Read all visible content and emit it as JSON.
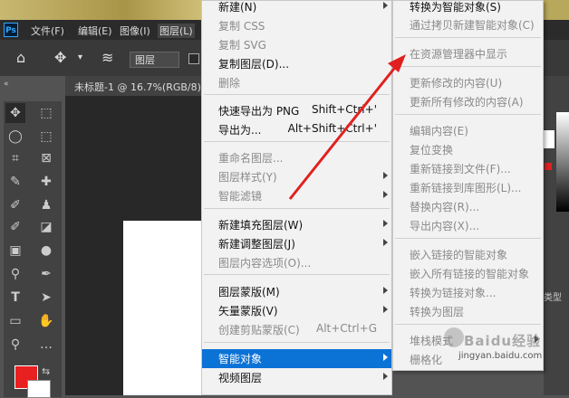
{
  "app": {
    "logo": "Ps",
    "menubar": [
      "文件(F)",
      "编辑(E)",
      "图像(I)",
      "图层(L)"
    ],
    "options": {
      "layer_select": "图层"
    },
    "doc_tab": "未标题-1 @ 16.7%(RGB/8)",
    "right_panel_label": "类型"
  },
  "icons": [
    "home-icon",
    "move-icon",
    "chevron-down-icon",
    "layers-stack-icon",
    "collapse-icon",
    "marquee-icon",
    "lasso-icon",
    "crop-icon",
    "eyedropper-icon",
    "brush-icon",
    "stamp-icon",
    "eraser-icon",
    "gradient-icon",
    "drop-icon",
    "pen-icon",
    "text-icon",
    "path-select-icon",
    "rectangle-icon",
    "hand-icon",
    "zoom-icon",
    "swap-colors-icon"
  ],
  "colors": {
    "foreground": "#e82020",
    "background": "#ffffff",
    "highlight": "#0b72d6",
    "arrow": "#e02020"
  },
  "menu1": {
    "items": [
      {
        "label": "新建(N)",
        "shortcut": "",
        "disabled": false,
        "submenu": true
      },
      {
        "label": "复制 CSS",
        "shortcut": "",
        "disabled": true,
        "submenu": false
      },
      {
        "label": "复制 SVG",
        "shortcut": "",
        "disabled": true,
        "submenu": false
      },
      {
        "label": "复制图层(D)...",
        "shortcut": "",
        "disabled": false,
        "submenu": false
      },
      {
        "label": "删除",
        "shortcut": "",
        "disabled": true,
        "submenu": false
      },
      {
        "label": "快速导出为 PNG",
        "shortcut": "Shift+Ctrl+'",
        "disabled": false,
        "submenu": false
      },
      {
        "label": "导出为...",
        "shortcut": "Alt+Shift+Ctrl+'",
        "disabled": false,
        "submenu": false
      },
      {
        "label": "重命名图层...",
        "shortcut": "",
        "disabled": true,
        "submenu": false
      },
      {
        "label": "图层样式(Y)",
        "shortcut": "",
        "disabled": true,
        "submenu": true
      },
      {
        "label": "智能滤镜",
        "shortcut": "",
        "disabled": true,
        "submenu": true
      },
      {
        "label": "新建填充图层(W)",
        "shortcut": "",
        "disabled": false,
        "submenu": true
      },
      {
        "label": "新建调整图层(J)",
        "shortcut": "",
        "disabled": false,
        "submenu": true
      },
      {
        "label": "图层内容选项(O)...",
        "shortcut": "",
        "disabled": true,
        "submenu": false
      },
      {
        "label": "图层蒙版(M)",
        "shortcut": "",
        "disabled": false,
        "submenu": true
      },
      {
        "label": "矢量蒙版(V)",
        "shortcut": "",
        "disabled": false,
        "submenu": true
      },
      {
        "label": "创建剪贴蒙版(C)",
        "shortcut": "Alt+Ctrl+G",
        "disabled": true,
        "submenu": false
      },
      {
        "label": "智能对象",
        "shortcut": "",
        "disabled": false,
        "submenu": true,
        "highlight": true
      },
      {
        "label": "视频图层",
        "shortcut": "",
        "disabled": false,
        "submenu": true
      }
    ]
  },
  "menu2": {
    "items": [
      {
        "label": "转换为智能对象(S)",
        "disabled": false,
        "submenu": false
      },
      {
        "label": "通过拷贝新建智能对象(C)",
        "disabled": true,
        "submenu": false
      },
      {
        "label": "在资源管理器中显示",
        "disabled": true,
        "submenu": false
      },
      {
        "label": "更新修改的内容(U)",
        "disabled": true,
        "submenu": false
      },
      {
        "label": "更新所有修改的内容(A)",
        "disabled": true,
        "submenu": false
      },
      {
        "label": "编辑内容(E)",
        "disabled": true,
        "submenu": false
      },
      {
        "label": "复位变换",
        "disabled": true,
        "submenu": false
      },
      {
        "label": "重新链接到文件(F)...",
        "disabled": true,
        "submenu": false
      },
      {
        "label": "重新链接到库图形(L)...",
        "disabled": true,
        "submenu": false
      },
      {
        "label": "替换内容(R)...",
        "disabled": true,
        "submenu": false
      },
      {
        "label": "导出内容(X)...",
        "disabled": true,
        "submenu": false
      },
      {
        "label": "嵌入链接的智能对象",
        "disabled": true,
        "submenu": false
      },
      {
        "label": "嵌入所有链接的智能对象",
        "disabled": true,
        "submenu": false
      },
      {
        "label": "转换为链接对象...",
        "disabled": true,
        "submenu": false
      },
      {
        "label": "转换为图层",
        "disabled": true,
        "submenu": false
      },
      {
        "label": "堆栈模式",
        "disabled": true,
        "submenu": true
      },
      {
        "label": "栅格化",
        "disabled": true,
        "submenu": false
      }
    ]
  },
  "watermark": {
    "text": "Baidu经验",
    "url": "jingyan.baidu.com"
  }
}
